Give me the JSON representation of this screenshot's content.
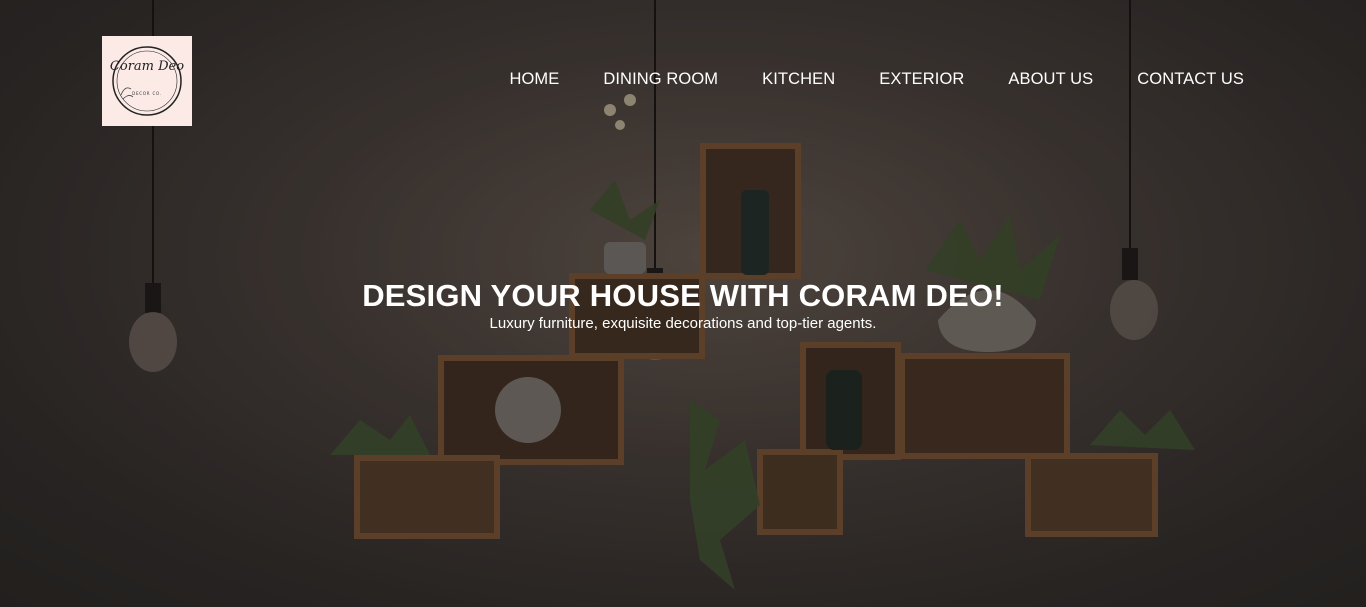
{
  "brand": {
    "logo_text_main": "Coram Deo",
    "logo_text_sub": "DECOR CO."
  },
  "nav": {
    "items": [
      {
        "label": "HOME"
      },
      {
        "label": "DINING ROOM"
      },
      {
        "label": "KITCHEN"
      },
      {
        "label": "EXTERIOR"
      },
      {
        "label": "ABOUT US"
      },
      {
        "label": "CONTACT US"
      }
    ]
  },
  "hero": {
    "title": "DESIGN YOUR HOUSE WITH CORAM DEO!",
    "subtitle": "Luxury furniture, exquisite decorations and top-tier agents."
  },
  "colors": {
    "background": "#2a2726",
    "logo_background": "#fbeae6",
    "text": "#ffffff",
    "wood": "#6b4a2e"
  }
}
